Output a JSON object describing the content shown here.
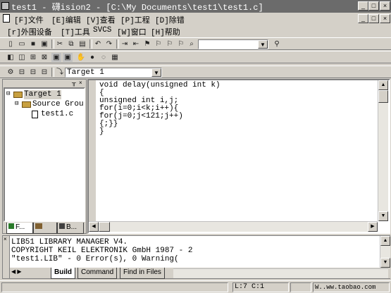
{
  "window": {
    "title": "test1  - 礴ision2 - [C:\\My Documents\\test1\\test1.c]",
    "controls": [
      "_",
      "□",
      "×"
    ],
    "mdi_controls": [
      "_",
      "□",
      "×"
    ]
  },
  "menu": {
    "row1": [
      "[F]文件",
      "[E]编辑",
      "[V]查看",
      "[P]工程",
      "[D]除错"
    ],
    "row2": [
      "[r]外围设备",
      "[T]工具",
      "SVCS",
      "[W]窗口",
      "[H]帮助"
    ]
  },
  "toolbar": {
    "find_combo_value": "",
    "target_combo_value": "Target 1"
  },
  "project": {
    "tree": [
      {
        "label": "Target 1",
        "expander": "⊟",
        "icon": "folder"
      },
      {
        "label": "Source Grou",
        "expander": "⊟",
        "icon": "folder"
      },
      {
        "label": "test1.c",
        "expander": "",
        "icon": "file"
      }
    ],
    "tabs": [
      "F...",
      "",
      "B..."
    ]
  },
  "editor": {
    "lines": [
      "void delay(unsigned int k)",
      "{",
      "unsigned int i,j;",
      "for(i=0;i<k;i++){",
      "for(j=0;j<121;j++)",
      "{;}}",
      "}"
    ]
  },
  "output": {
    "lines": [
      "LIB51 LIBRARY MANAGER V4.",
      "COPYRIGHT KEIL ELEKTRONIK GmbH 1987 - 2",
      "\"test1.LIB\" - 0 Error(s), 0 Warning("
    ],
    "tabs": [
      "Build",
      "Command",
      "Find in Files"
    ]
  },
  "status": {
    "position": "L:7 C:1",
    "right": "W..ww.taobao.com"
  },
  "colors": {
    "titlebar": "#6b6b6b",
    "face": "#d4d0c8",
    "editor_bg": "#ffffff"
  }
}
